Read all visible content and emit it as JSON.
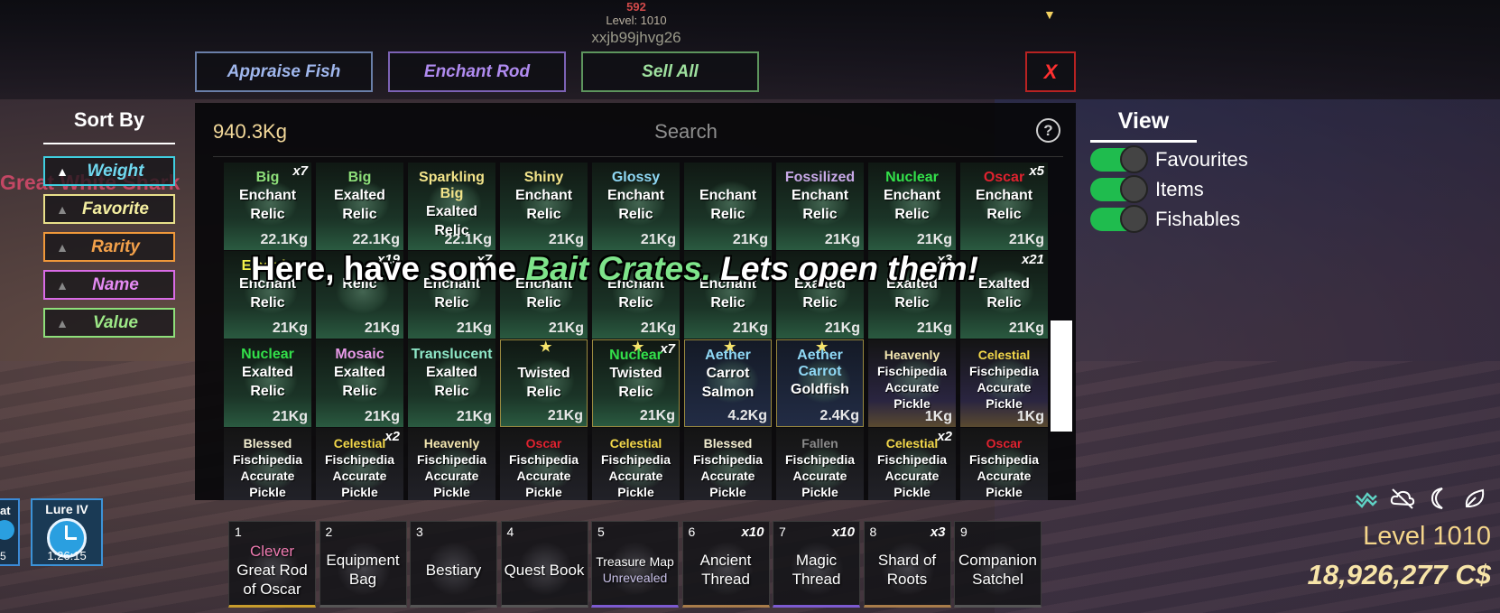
{
  "hud_top": {
    "number": "592",
    "level": "Level: 1010",
    "username": "xxjb99jhvg26"
  },
  "actions": {
    "appraise": "Appraise Fish",
    "enchant": "Enchant Rod",
    "sell": "Sell All",
    "close": "X"
  },
  "inventory": {
    "total_weight": "940.3Kg",
    "search_placeholder": "Search",
    "help": "?"
  },
  "banner": {
    "part1": "Here, have some ",
    "highlight": "Bait Crates.",
    "part2": " Lets open them!"
  },
  "sort": {
    "title": "Sort By",
    "options": [
      {
        "label": "Weight",
        "color": "#70d8ef"
      },
      {
        "label": "Favorite",
        "color": "#f4eea0"
      },
      {
        "label": "Rarity",
        "color": "#f2a04a"
      },
      {
        "label": "Name",
        "color": "#e48af2"
      },
      {
        "label": "Value",
        "color": "#9de887"
      }
    ]
  },
  "world_label": "Great White Shark",
  "view": {
    "title": "View",
    "toggles": [
      {
        "label": "Favourites",
        "on": true
      },
      {
        "label": "Items",
        "on": true
      },
      {
        "label": "Fishables",
        "on": true
      }
    ]
  },
  "items": [
    {
      "prefix": "Big",
      "prefix_color": "#8ee07a",
      "name": [
        "Enchant",
        "Relic"
      ],
      "weight": "22.1Kg",
      "qty": "x7"
    },
    {
      "prefix": "Big",
      "prefix_color": "#8ee07a",
      "name": [
        "Exalted",
        "Relic"
      ],
      "weight": "22.1Kg",
      "qty": ""
    },
    {
      "prefix": "Sparkling Big",
      "prefix_color": "#f3e48a",
      "name": [
        "Exalted Relic"
      ],
      "weight": "22.1Kg",
      "qty": ""
    },
    {
      "prefix": "Shiny",
      "prefix_color": "#f3e48a",
      "name": [
        "Enchant",
        "Relic"
      ],
      "weight": "21Kg",
      "qty": ""
    },
    {
      "prefix": "Glossy",
      "prefix_color": "#8fd8f5",
      "name": [
        "Enchant",
        "Relic"
      ],
      "weight": "21Kg",
      "qty": ""
    },
    {
      "prefix": "",
      "prefix_color": "#ffffff",
      "name": [
        "Enchant",
        "Relic"
      ],
      "weight": "21Kg",
      "qty": ""
    },
    {
      "prefix": "Fossilized",
      "prefix_color": "#c9a9e8",
      "name": [
        "Enchant Relic"
      ],
      "weight": "21Kg",
      "qty": ""
    },
    {
      "prefix": "Nuclear",
      "prefix_color": "#33e04a",
      "name": [
        "Enchant",
        "Relic"
      ],
      "weight": "21Kg",
      "qty": ""
    },
    {
      "prefix": "Oscar",
      "prefix_color": "#e0222f",
      "name": [
        "Enchant",
        "Relic"
      ],
      "weight": "21Kg",
      "qty": "x5"
    },
    {
      "prefix": "Electric",
      "prefix_color": "#f3f04a",
      "name": [
        "Enchant Relic"
      ],
      "weight": "21Kg",
      "qty": ""
    },
    {
      "prefix": "",
      "prefix_color": "#ffffff",
      "name": [
        "Relic"
      ],
      "weight": "21Kg",
      "qty": "x19"
    },
    {
      "prefix": "",
      "prefix_color": "#ffffff",
      "name": [
        "Enchant",
        "Relic"
      ],
      "weight": "21Kg",
      "qty": "x7"
    },
    {
      "prefix": "",
      "prefix_color": "#ffffff",
      "name": [
        "Enchant Relic"
      ],
      "weight": "21Kg",
      "qty": ""
    },
    {
      "prefix": "",
      "prefix_color": "#ffffff",
      "name": [
        "Enchant Relic"
      ],
      "weight": "21Kg",
      "qty": ""
    },
    {
      "prefix": "",
      "prefix_color": "#ffffff",
      "name": [
        "Enchant Relic"
      ],
      "weight": "21Kg",
      "qty": ""
    },
    {
      "prefix": "",
      "prefix_color": "#ffffff",
      "name": [
        "Exalted",
        "Relic"
      ],
      "weight": "21Kg",
      "qty": ""
    },
    {
      "prefix": "",
      "prefix_color": "#ffffff",
      "name": [
        "Exalted",
        "Relic"
      ],
      "weight": "21Kg",
      "qty": "x3"
    },
    {
      "prefix": "",
      "prefix_color": "#ffffff",
      "name": [
        "Exalted",
        "Relic"
      ],
      "weight": "21Kg",
      "qty": "x21"
    },
    {
      "prefix": "Nuclear",
      "prefix_color": "#33e04a",
      "name": [
        "Exalted",
        "Relic"
      ],
      "weight": "21Kg",
      "qty": ""
    },
    {
      "prefix": "Mosaic",
      "prefix_color": "#e89ae8",
      "name": [
        "Exalted",
        "Relic"
      ],
      "weight": "21Kg",
      "qty": ""
    },
    {
      "prefix": "Translucent",
      "prefix_color": "#8fe8c8",
      "name": [
        "Exalted Relic"
      ],
      "weight": "21Kg",
      "qty": ""
    },
    {
      "prefix": "",
      "prefix_color": "#ffffff",
      "name": [
        "Twisted",
        "Relic"
      ],
      "weight": "21Kg",
      "qty": "",
      "fav": true
    },
    {
      "prefix": "Nuclear",
      "prefix_color": "#33e04a",
      "name": [
        "Twisted",
        "Relic"
      ],
      "weight": "21Kg",
      "qty": "x7",
      "fav": true
    },
    {
      "prefix": "Aether",
      "prefix_color": "#8fd8f5",
      "name": [
        "Carrot",
        "Salmon"
      ],
      "weight": "4.2Kg",
      "qty": "",
      "fav": true
    },
    {
      "prefix": "Aether Carrot",
      "prefix_color": "#8fd8f5",
      "name": [
        "Goldfish"
      ],
      "weight": "2.4Kg",
      "qty": "",
      "fav": true
    },
    {
      "prefix": "Heavenly",
      "prefix_color": "#f3e6b0",
      "name": [
        "Fischipedia",
        "Accurate",
        "Pickle"
      ],
      "weight": "1Kg",
      "qty": ""
    },
    {
      "prefix": "Celestial",
      "prefix_color": "#f3d84a",
      "name": [
        "Fischipedia",
        "Accurate",
        "Pickle"
      ],
      "weight": "1Kg",
      "qty": ""
    },
    {
      "prefix": "Blessed",
      "prefix_color": "#f3eed0",
      "name": [
        "Fischipedia",
        "Accurate",
        "Pickle"
      ],
      "weight": "",
      "qty": ""
    },
    {
      "prefix": "Celestial",
      "prefix_color": "#f3d84a",
      "name": [
        "Fischipedia",
        "Accurate",
        "Pickle"
      ],
      "weight": "",
      "qty": "x2"
    },
    {
      "prefix": "Heavenly",
      "prefix_color": "#f3e6b0",
      "name": [
        "Fischipedia",
        "Accurate",
        "Pickle"
      ],
      "weight": "",
      "qty": ""
    },
    {
      "prefix": "Oscar",
      "prefix_color": "#e0222f",
      "name": [
        "Fischipedia",
        "Accurate",
        "Pickle"
      ],
      "weight": "",
      "qty": ""
    },
    {
      "prefix": "Celestial",
      "prefix_color": "#f3d84a",
      "name": [
        "Fischipedia",
        "Accurate",
        "Pickle"
      ],
      "weight": "",
      "qty": ""
    },
    {
      "prefix": "Blessed",
      "prefix_color": "#f3eed0",
      "name": [
        "Fischipedia",
        "Accurate",
        "Pickle"
      ],
      "weight": "",
      "qty": ""
    },
    {
      "prefix": "Fallen",
      "prefix_color": "#8a8a8a",
      "name": [
        "Fischipedia",
        "Accurate",
        "Pickle"
      ],
      "weight": "",
      "qty": ""
    },
    {
      "prefix": "Celestial",
      "prefix_color": "#f3d84a",
      "name": [
        "Fischipedia",
        "Accurate",
        "Pickle"
      ],
      "weight": "",
      "qty": "x2"
    },
    {
      "prefix": "Oscar",
      "prefix_color": "#e0222f",
      "name": [
        "Fischipedia",
        "Accurate",
        "Pickle"
      ],
      "weight": "",
      "qty": ""
    }
  ],
  "left_bag": {
    "label": "at",
    "value": "5"
  },
  "lure": {
    "label": "Lure IV",
    "time": "1:26:15"
  },
  "hotbar": [
    {
      "slot": "1",
      "lines": [
        "Clever",
        "Great Rod",
        "of Oscar"
      ],
      "qty": ""
    },
    {
      "slot": "2",
      "lines": [
        "Equipment",
        "Bag"
      ],
      "qty": ""
    },
    {
      "slot": "3",
      "lines": [
        "Bestiary"
      ],
      "qty": ""
    },
    {
      "slot": "4",
      "lines": [
        "Quest Book"
      ],
      "qty": ""
    },
    {
      "slot": "5",
      "lines": [
        "Treasure Map",
        "Unrevealed"
      ],
      "qty": ""
    },
    {
      "slot": "6",
      "lines": [
        "Ancient",
        "Thread"
      ],
      "qty": "x10"
    },
    {
      "slot": "7",
      "lines": [
        "Magic",
        "Thread"
      ],
      "qty": "x10"
    },
    {
      "slot": "8",
      "lines": [
        "Shard of",
        "Roots"
      ],
      "qty": "x3"
    },
    {
      "slot": "9",
      "lines": [
        "Companion",
        "Satchel"
      ],
      "qty": ""
    }
  ],
  "status_icons": [
    "wind-icon",
    "cloud-off-icon",
    "moon-icon",
    "leaf-icon"
  ],
  "player": {
    "level": "Level 1010",
    "cash": "18,926,277 C$"
  }
}
